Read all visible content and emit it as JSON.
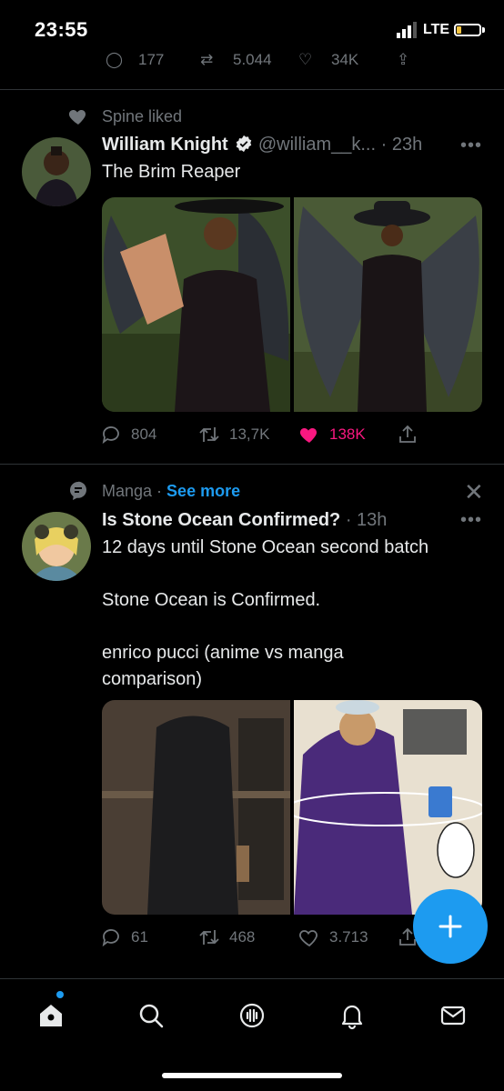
{
  "status_bar": {
    "time": "23:55",
    "network": "LTE",
    "battery_percent": 20
  },
  "previous_tweet": {
    "replies": "177",
    "retweets": "5.044",
    "likes": "34K"
  },
  "tweets": [
    {
      "context": "Spine liked",
      "author_name": "William Knight",
      "verified": true,
      "handle": "@william__k...",
      "time": "· 23h",
      "text": "The Brim Reaper",
      "replies": "804",
      "retweets": "13,7K",
      "likes": "138K",
      "liked": true
    },
    {
      "context_topic": "Manga",
      "context_sep": " · ",
      "context_action": "See more",
      "author_name": "Is Stone Ocean Confirmed?",
      "time": "· 13h",
      "text": "12 days until Stone Ocean second batch\n\nStone Ocean is Confirmed.\n\nenrico pucci (anime vs manga\ncomparison)",
      "replies": "61",
      "retweets": "468",
      "likes": "3.713"
    }
  ],
  "colors": {
    "accent": "#1d9bf0",
    "like": "#f91880",
    "muted": "#71767b",
    "background": "#000000"
  },
  "tabs": [
    "home-icon",
    "search-icon",
    "spaces-icon",
    "notifications-icon",
    "messages-icon"
  ]
}
